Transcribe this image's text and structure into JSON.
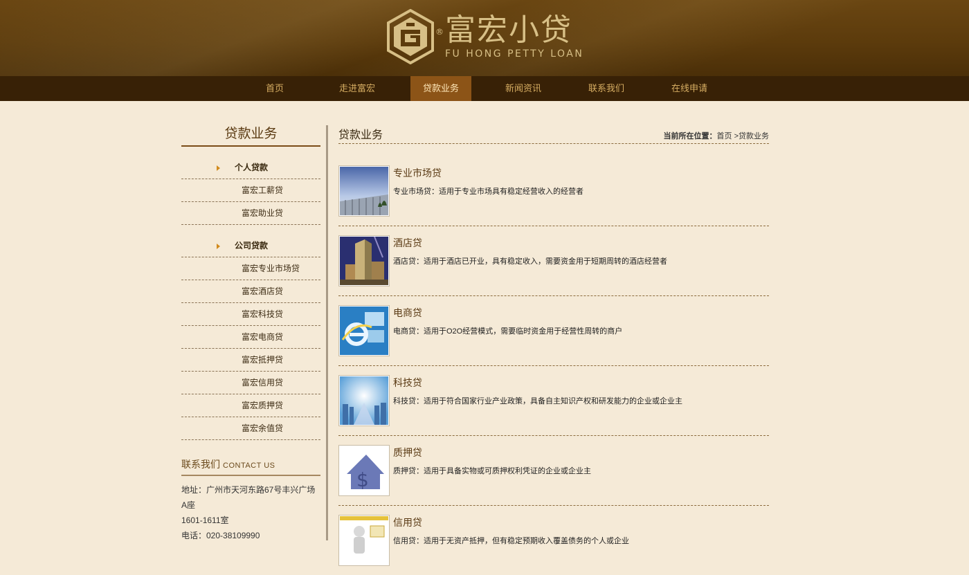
{
  "header": {
    "logo": {
      "name_cn": "富宏小贷",
      "name_en": "FU HONG PETTY LOAN",
      "reg_mark": "®",
      "icon": "fuhong-logo-icon",
      "color": "#d7bf86"
    }
  },
  "nav": {
    "items": [
      {
        "label": "首页"
      },
      {
        "label": "走进富宏"
      },
      {
        "label": "贷款业务",
        "active": true
      },
      {
        "label": "新闻资讯"
      },
      {
        "label": "联系我们"
      },
      {
        "label": "在线申请"
      }
    ],
    "active_bg": "#8c5417"
  },
  "sidebar": {
    "title": "贷款业务",
    "categories": [
      {
        "label": "个人贷款",
        "items": [
          "富宏工薪贷",
          "富宏助业贷"
        ]
      },
      {
        "label": "公司贷款",
        "items": [
          "富宏专业市场贷",
          "富宏酒店贷",
          "富宏科技贷",
          "富宏电商贷",
          "富宏抵押贷",
          "富宏信用贷",
          "富宏质押贷",
          "富宏余值贷"
        ]
      }
    ],
    "contact": {
      "title_cn": "联系我们",
      "title_en": "CONTACT US",
      "address_line1": "地址：广州市天河东路67号丰兴广场A座",
      "address_line2": "1601-1611室",
      "phone": "电话：020-38109990"
    }
  },
  "main": {
    "title": "贷款业务",
    "breadcrumb": {
      "label": "当前所在位置：",
      "home": "首页",
      "sep": " >",
      "current": "贷款业务"
    },
    "items": [
      {
        "title": "专业市场贷",
        "desc": "专业市场贷：适用于专业市场具有稳定经营收入的经营者",
        "image": "market-building-image"
      },
      {
        "title": "酒店贷",
        "desc": "酒店贷：适用于酒店已开业，具有稳定收入，需要资金用于短期周转的酒店经营者",
        "image": "hotel-building-image"
      },
      {
        "title": "电商贷",
        "desc": "电商贷：适用于O2O经营模式，需要临时资金用于经营性周转的商户",
        "image": "ecommerce-ie-image"
      },
      {
        "title": "科技贷",
        "desc": "科技贷：适用于符合国家行业产业政策，具备自主知识产权和研发能力的企业或企业主",
        "image": "tech-city-image"
      },
      {
        "title": "质押贷",
        "desc": "质押贷：适用于具备实物或可质押权利凭证的企业或企业主",
        "image": "pledge-house-dollar-image"
      },
      {
        "title": "信用贷",
        "desc": "信用贷：适用于无资产抵押，但有稳定预期收入覆盖债务的个人或企业",
        "image": "credit-figure-image"
      }
    ]
  }
}
